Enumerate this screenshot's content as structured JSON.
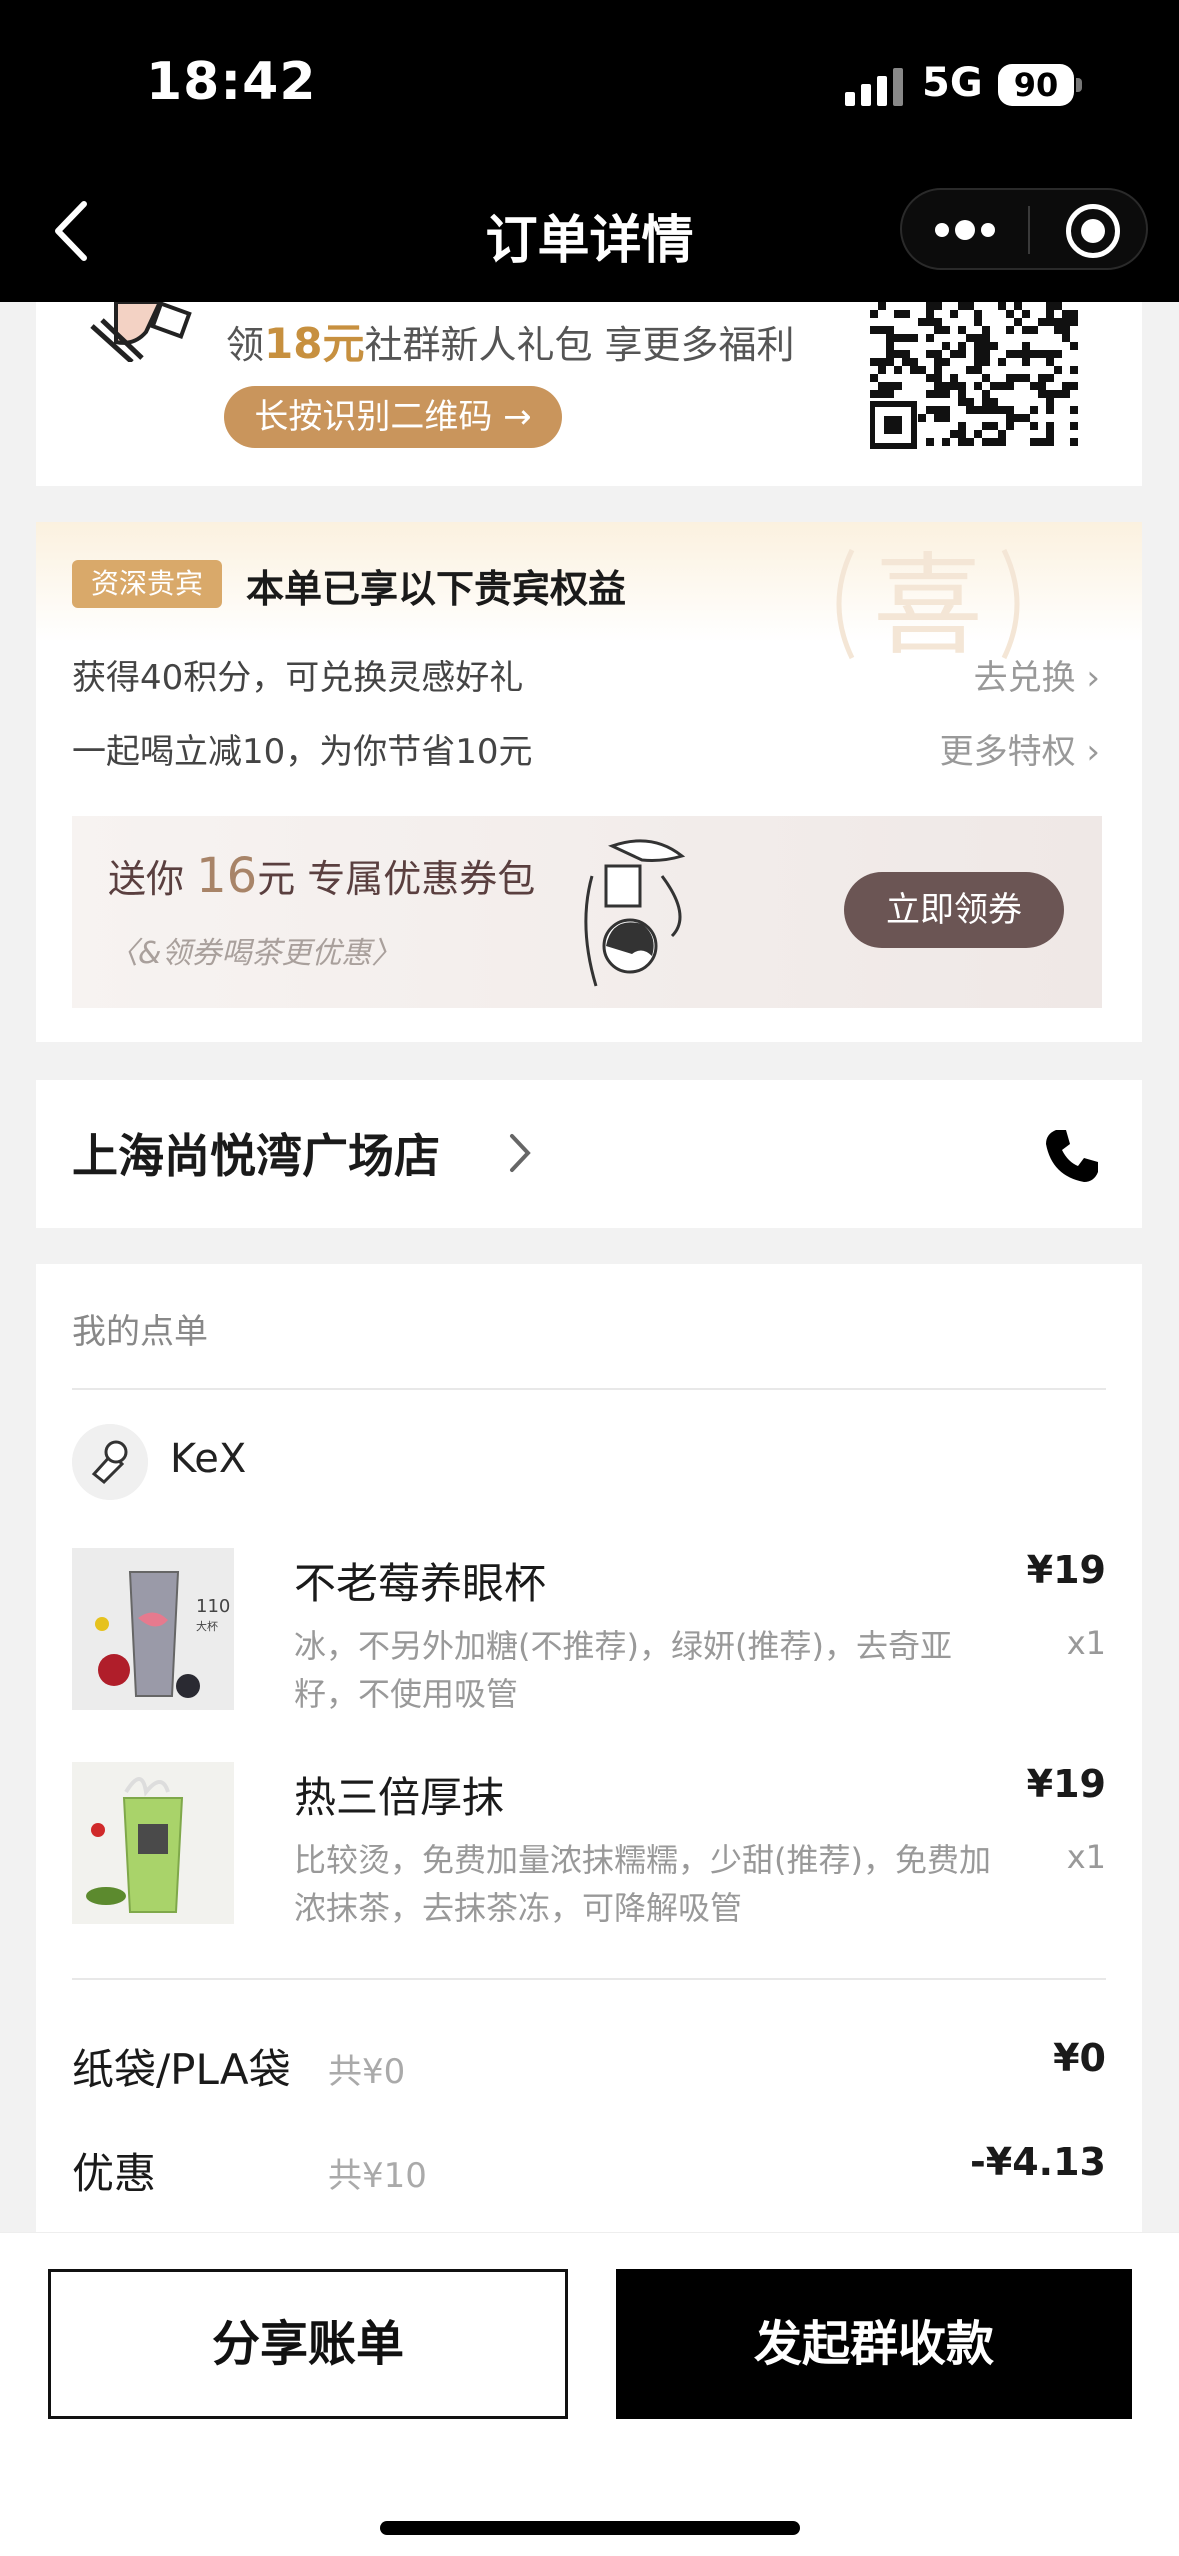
{
  "status_bar": {
    "time": "18:42",
    "network": "5G",
    "battery": "90"
  },
  "nav": {
    "title": "订单详情"
  },
  "community": {
    "text_prefix": "领",
    "amount": "18元",
    "text_suffix": "社群新人礼包 享更多福利",
    "button": "长按识别二维码 →"
  },
  "vip": {
    "badge": "资深贵宾",
    "title": "本单已享以下贵宾权益",
    "seal_char": "喜",
    "rows": [
      {
        "text": "获得40积分，可兑换灵感好礼",
        "link": "去兑换 ›"
      },
      {
        "text": "一起喝立减10，为你节省10元",
        "link": "更多特权 ›"
      }
    ],
    "coupon": {
      "prefix": "送你",
      "amount": "16",
      "suffix": "元 专属优惠券包",
      "subtitle": "〈&领券喝茶更优惠〉",
      "button": "立即领券"
    }
  },
  "store": {
    "name": "上海尚悦湾广场店"
  },
  "order": {
    "label": "我的点单",
    "user": "KeX",
    "items": [
      {
        "name": "不老莓养眼杯",
        "desc": "冰，不另外加糖(不推荐)，绿妍(推荐)，去奇亚籽，不使用吸管",
        "price": "¥19",
        "qty": "x1",
        "image_label": "110",
        "image_sub": "大杯"
      },
      {
        "name": "热三倍厚抹",
        "desc": "比较烫，免费加量浓抹糯糯，少甜(推荐)，免费加浓抹茶，去抹茶冻，可降解吸管",
        "price": "¥19",
        "qty": "x1"
      }
    ],
    "fees": [
      {
        "name": "纸袋/PLA袋",
        "sub": "共¥0",
        "value": "¥0"
      },
      {
        "name": "优惠",
        "sub": "共¥10",
        "value": "-¥4.13"
      }
    ]
  },
  "actions": {
    "share": "分享账单",
    "collect": "发起群收款"
  }
}
